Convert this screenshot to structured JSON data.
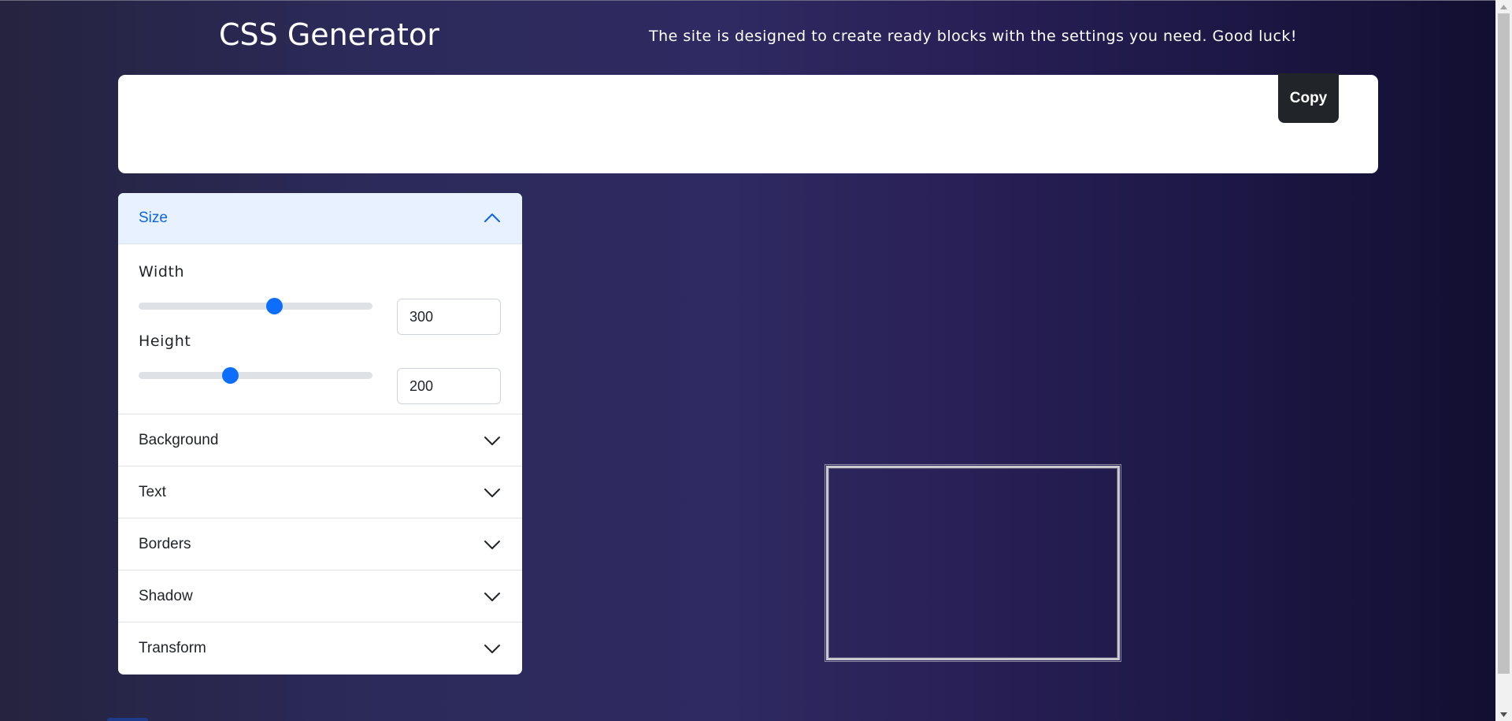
{
  "header": {
    "title": "CSS Generator",
    "tagline": "The site is designed to create ready blocks with the settings you need. Good luck!"
  },
  "output": {
    "code": "",
    "copy_label": "Copy"
  },
  "accordion": {
    "size": {
      "label": "Size",
      "expanded": true,
      "width": {
        "label": "Width",
        "value": "300",
        "slider_fraction": 0.58
      },
      "height": {
        "label": "Height",
        "value": "200",
        "slider_fraction": 0.39
      }
    },
    "sections": [
      {
        "key": "background",
        "label": "Background"
      },
      {
        "key": "text",
        "label": "Text"
      },
      {
        "key": "borders",
        "label": "Borders"
      },
      {
        "key": "shadow",
        "label": "Shadow"
      },
      {
        "key": "transform",
        "label": "Transform"
      }
    ]
  },
  "icons": {
    "expanded": "chevron-up-icon",
    "collapsed": "chevron-down-icon",
    "scroll_up": "scroll-up-arrow-icon",
    "scroll_down": "scroll-down-arrow-icon"
  },
  "colors": {
    "accent": "#0d6efd",
    "accordion_active_bg": "#e7f1ff",
    "accordion_active_text": "#0c63e4",
    "copy_button": "#212529"
  }
}
